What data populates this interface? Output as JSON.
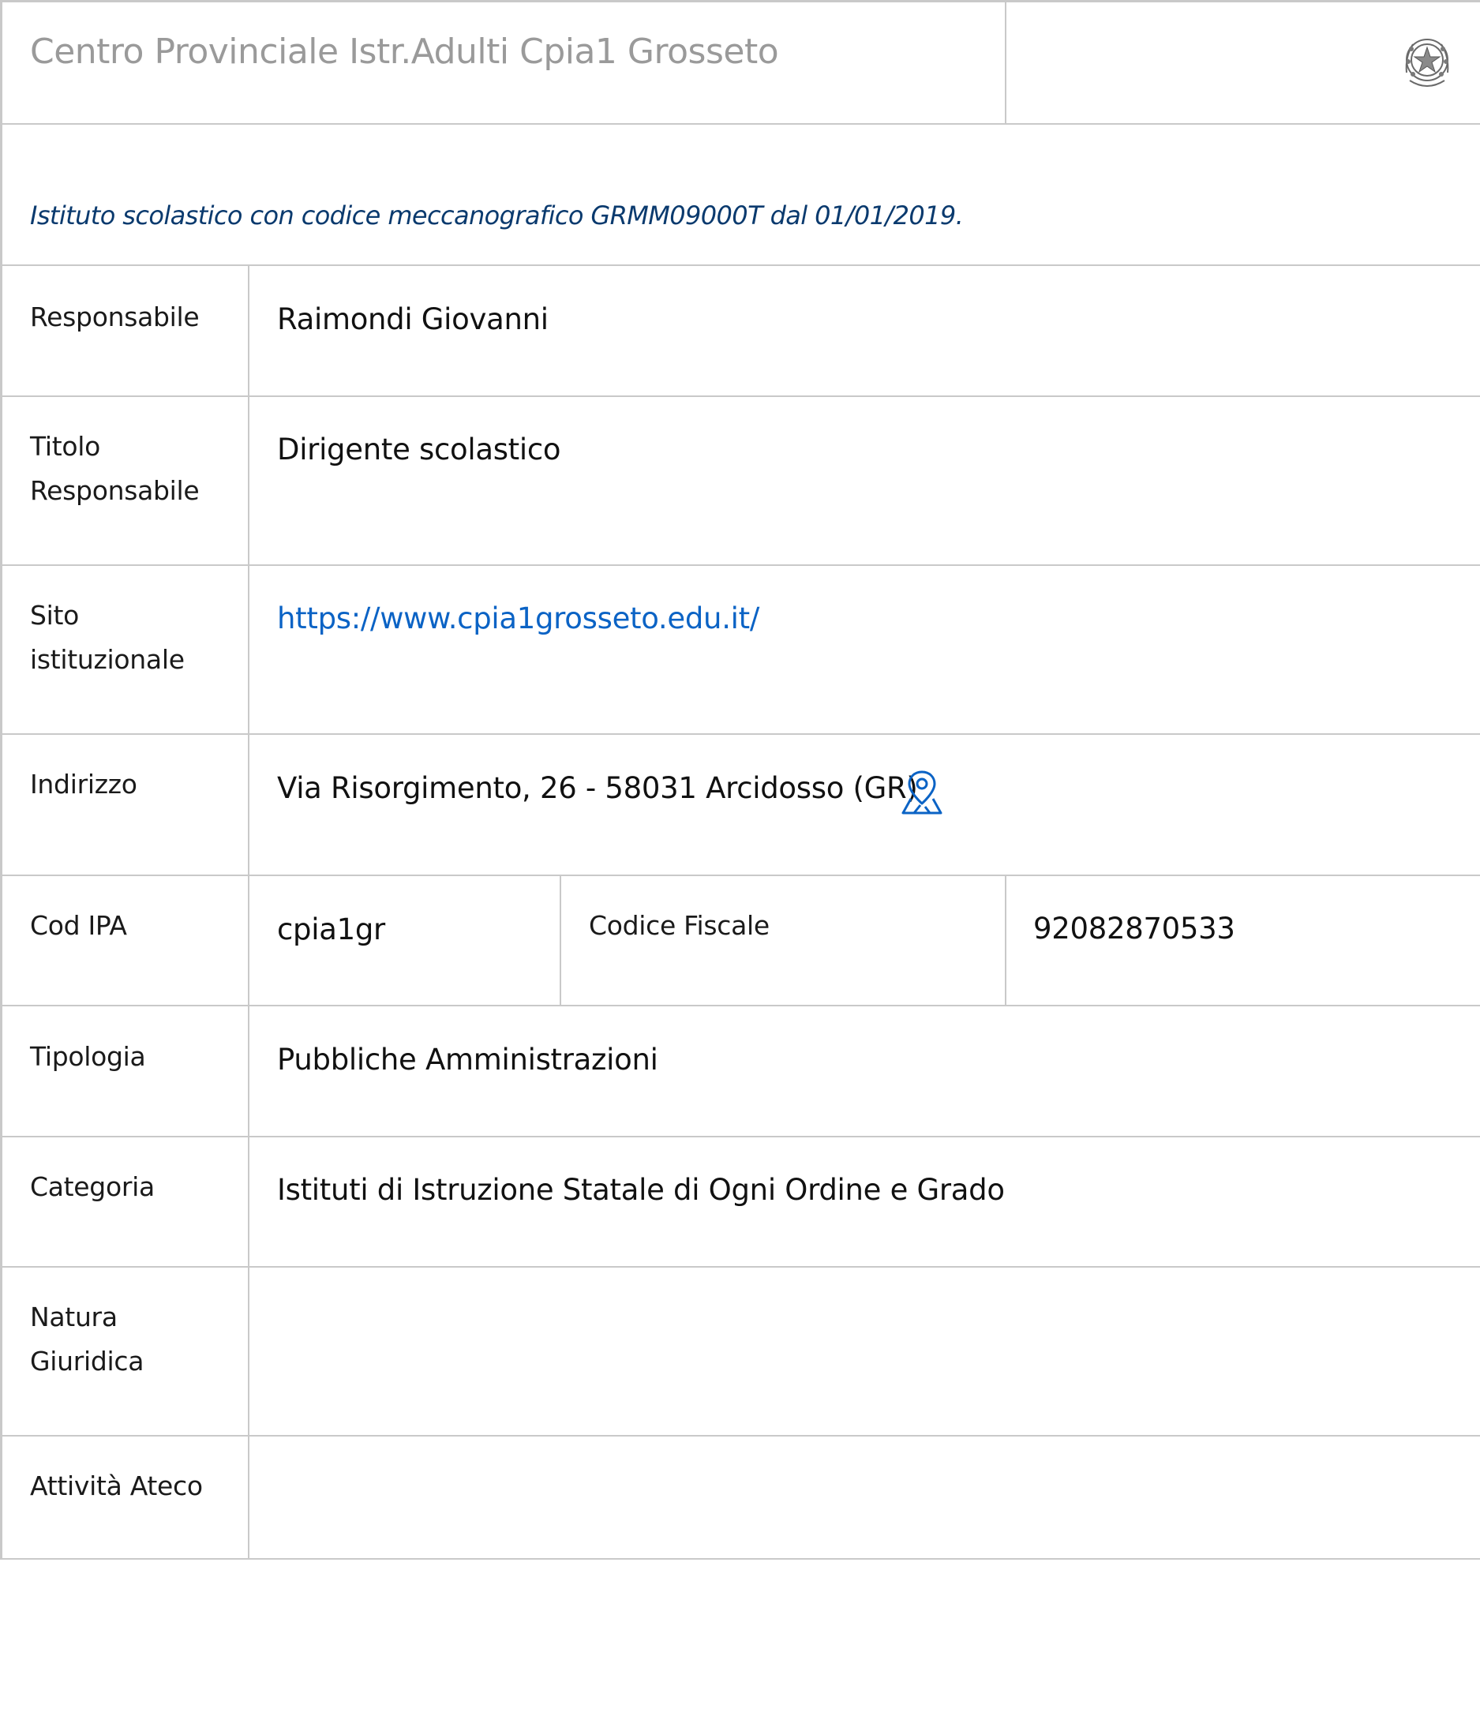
{
  "header": {
    "title": "Centro Provinciale Istr.Adulti Cpia1 Grosseto",
    "emblem_icon": "italian-republic-emblem-icon"
  },
  "subtitle": "Istituto scolastico con codice meccanografico GRMM09000T dal 01/01/2019.",
  "rows": {
    "responsabile": {
      "label": "Responsabile",
      "value": "Raimondi Giovanni"
    },
    "titolo_responsabile": {
      "label_line1": "Titolo",
      "label_line2": "Responsabile",
      "value": "Dirigente scolastico"
    },
    "sito": {
      "label_line1": "Sito",
      "label_line2": "istituzionale",
      "value": "https://www.cpia1grosseto.edu.it/"
    },
    "indirizzo": {
      "label": "Indirizzo",
      "value": "Via Risorgimento, 26 - 58031 Arcidosso (GR)",
      "icon": "map-pin-icon"
    },
    "cod_ipa": {
      "label": "Cod IPA",
      "value": "cpia1gr"
    },
    "codice_fiscale": {
      "label": "Codice Fiscale",
      "value": "92082870533"
    },
    "tipologia": {
      "label": "Tipologia",
      "value": "Pubbliche Amministrazioni"
    },
    "categoria": {
      "label": "Categoria",
      "value": "Istituti di Istruzione Statale di Ogni Ordine e Grado"
    },
    "natura_giuridica": {
      "label_line1": "Natura",
      "label_line2": "Giuridica",
      "value": ""
    },
    "attivita_ateco": {
      "label": "Attività Ateco",
      "value": ""
    }
  },
  "colors": {
    "title_gray": "#9a9a9a",
    "subtitle_blue": "#0a3a6e",
    "link_blue": "#0b63c5",
    "border_gray": "#c9c9c9"
  }
}
